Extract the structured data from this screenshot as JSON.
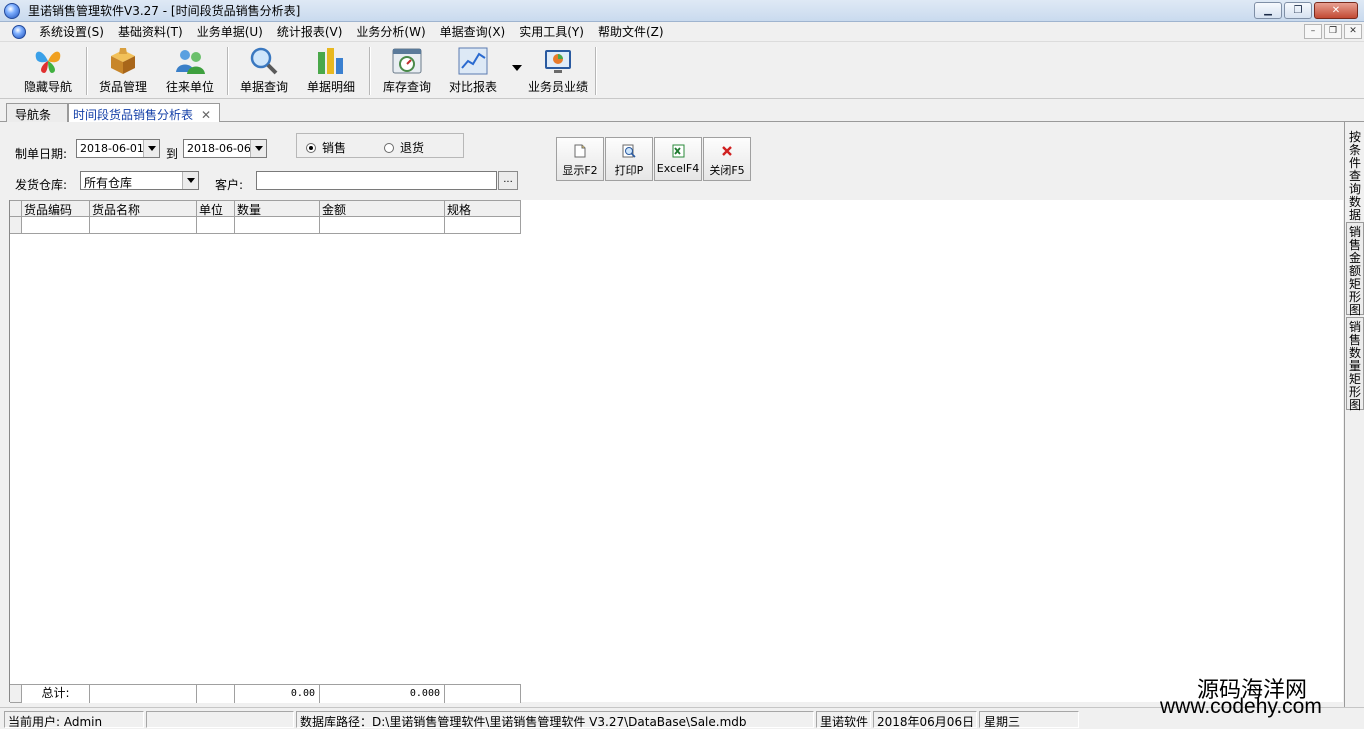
{
  "window": {
    "title": "里诺销售管理软件V3.27 - [时间段货品销售分析表]"
  },
  "menu": {
    "items": [
      "系统设置(S)",
      "基础资料(T)",
      "业务单据(U)",
      "统计报表(V)",
      "业务分析(W)",
      "单据查询(X)",
      "实用工具(Y)",
      "帮助文件(Z)"
    ]
  },
  "toolbar": {
    "buttons": [
      {
        "label": "隐藏导航",
        "icon": "butterfly-icon"
      },
      {
        "label": "货品管理",
        "icon": "package-icon"
      },
      {
        "label": "往来单位",
        "icon": "users-icon"
      },
      {
        "label": "单据查询",
        "icon": "magnifier-icon"
      },
      {
        "label": "单据明细",
        "icon": "bar-chart-icon"
      },
      {
        "label": "库存查询",
        "icon": "gauge-icon"
      },
      {
        "label": "对比报表",
        "icon": "line-chart-icon"
      },
      {
        "label": "业务员业绩",
        "icon": "monitor-icon"
      }
    ]
  },
  "tabs": [
    {
      "label": "导航条",
      "active": false
    },
    {
      "label": "时间段货品销售分析表",
      "active": true,
      "close": "✕"
    }
  ],
  "filters": {
    "date_label": "制单日期:",
    "date_from": "2018-06-01",
    "to_label": "到",
    "date_to": "2018-06-06",
    "warehouse_label": "发货仓库:",
    "warehouse_value": "所有仓库",
    "customer_label": "客户:",
    "customer_value": "",
    "dots": "...",
    "radio_sale": "销售",
    "radio_return": "退货",
    "selected": "销售"
  },
  "actions": {
    "show": "显示F2",
    "print": "打印P",
    "excel": "ExcelF4",
    "close": "关闭F5"
  },
  "grid": {
    "columns": [
      "货品编码",
      "货品名称",
      "单位",
      "数量",
      "金额",
      "规格"
    ],
    "rows": [],
    "footer": {
      "label": "总计:",
      "quantity": "0.00",
      "amount": "0.000"
    }
  },
  "side_tabs": [
    "按条件查询数据",
    "销售金额矩形图",
    "销售数量矩形图"
  ],
  "status": {
    "user": "当前用户: Admin",
    "blank": "",
    "db_path": "数据库路径：D:\\里诺销售管理软件\\里诺销售管理软件 V3.27\\DataBase\\Sale.mdb",
    "company": "里诺软件",
    "date": "2018年06月06日",
    "weekday": "星期三"
  },
  "watermark": {
    "line1": "源码海洋网",
    "line2": "www.codehy.com"
  },
  "colors": {
    "active_tab_text": "#1440a8",
    "close_button": "#c24a34"
  }
}
